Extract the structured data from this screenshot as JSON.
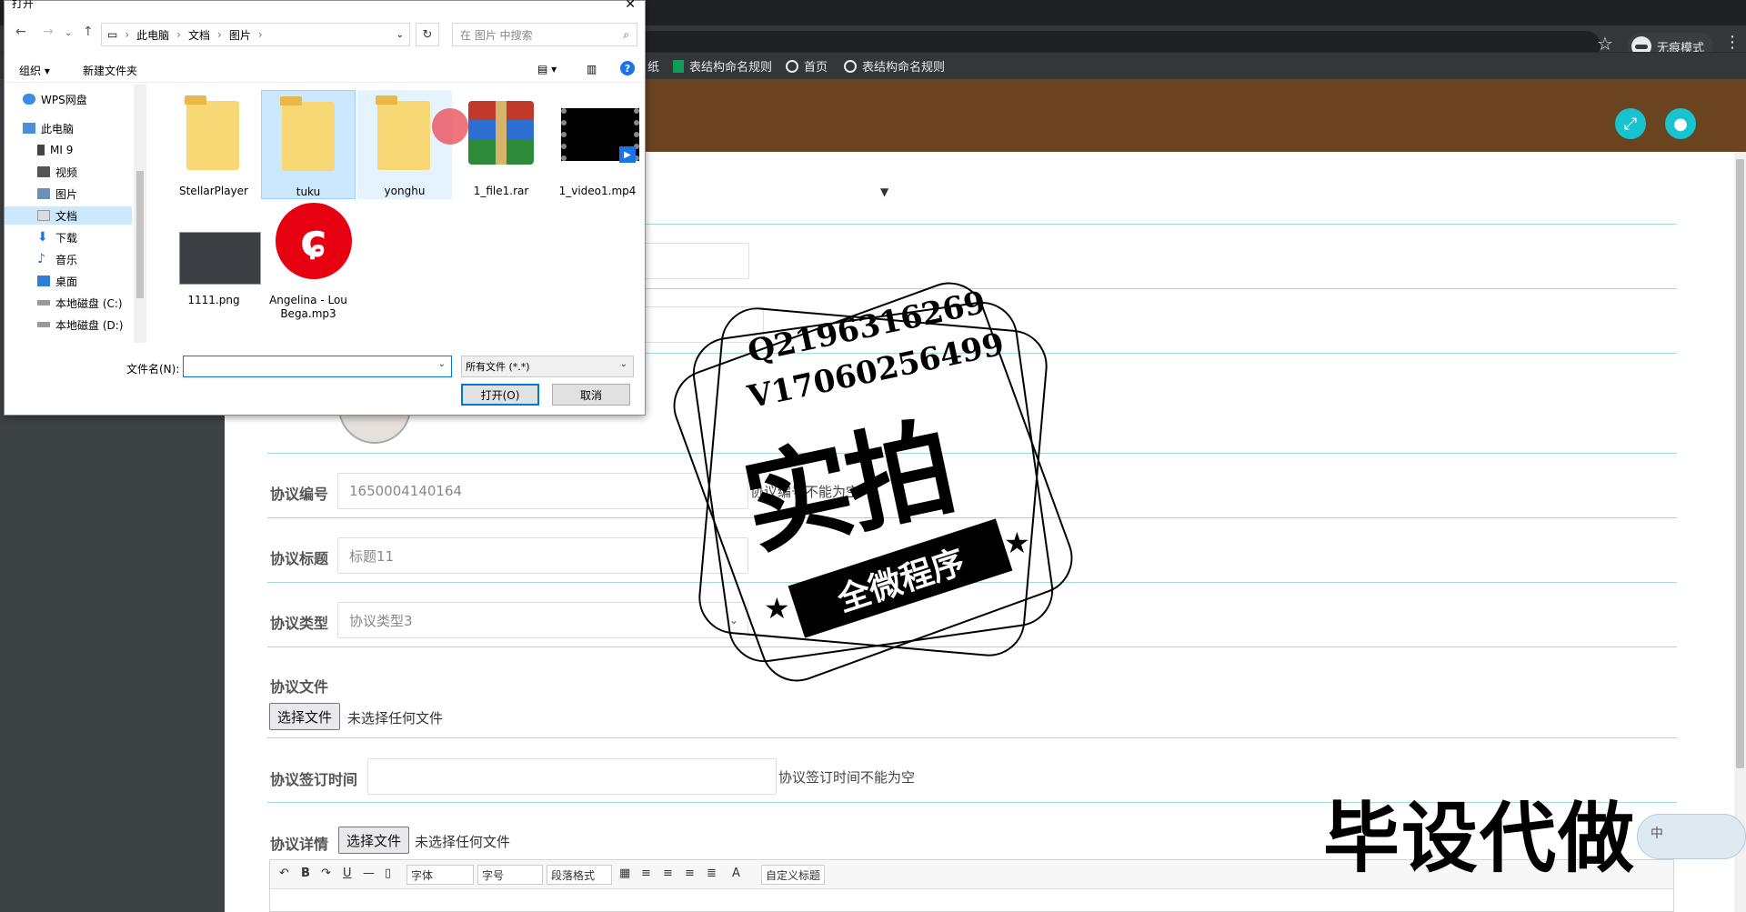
{
  "browser": {
    "incognito_label": "无痕模式",
    "bookmarks": [
      {
        "label": "纸"
      },
      {
        "label": "表结构命名规则"
      },
      {
        "label": "首页"
      },
      {
        "label": "表结构命名规则"
      }
    ]
  },
  "form": {
    "agreement_no": {
      "label": "协议编号",
      "value": "1650004140164",
      "error": "协议编号不能为空"
    },
    "agreement_title": {
      "label": "协议标题",
      "value": "标题11"
    },
    "agreement_type": {
      "label": "协议类型",
      "value": "协议类型3"
    },
    "agreement_file": {
      "label": "协议文件",
      "button": "选择文件",
      "status": "未选择任何文件"
    },
    "sign_time": {
      "label": "协议签订时间",
      "value": "",
      "error": "协议签订时间不能为空"
    },
    "details": {
      "label": "协议详情",
      "button": "选择文件",
      "status": "未选择任何文件"
    }
  },
  "editor": {
    "font_label": "字体",
    "size_label": "字号",
    "para_label": "段落格式",
    "custom_label": "自定义标题"
  },
  "watermark": {
    "qq": "Q2196316269",
    "vx": "V17060256499",
    "big": "实拍",
    "ribbon": "全微程序",
    "corner": "毕设代做",
    "ime": "中"
  },
  "dialog": {
    "title": "打开",
    "breadcrumb": [
      "此电脑",
      "文档",
      "图片"
    ],
    "search_placeholder": "在 图片 中搜索",
    "organize": "组织 ▾",
    "new_folder": "新建文件夹",
    "tree": [
      "WPS网盘",
      "此电脑",
      "MI 9",
      "视频",
      "图片",
      "文档",
      "下载",
      "音乐",
      "桌面",
      "本地磁盘 (C:)",
      "本地磁盘 (D:)"
    ],
    "files": [
      {
        "name": "StellarPlayer",
        "kind": "folder"
      },
      {
        "name": "tuku",
        "kind": "folder"
      },
      {
        "name": "yonghu",
        "kind": "folder"
      },
      {
        "name": "1_file1.rar",
        "kind": "rar"
      },
      {
        "name": "1_video1.mp4",
        "kind": "video"
      },
      {
        "name": "1111.png",
        "kind": "image"
      },
      {
        "name": "Angelina - Lou Bega.mp3",
        "kind": "audio"
      }
    ],
    "filename_label": "文件名(N):",
    "filetype": "所有文件 (*.*)",
    "open_button": "打开(O)",
    "cancel_button": "取消"
  }
}
